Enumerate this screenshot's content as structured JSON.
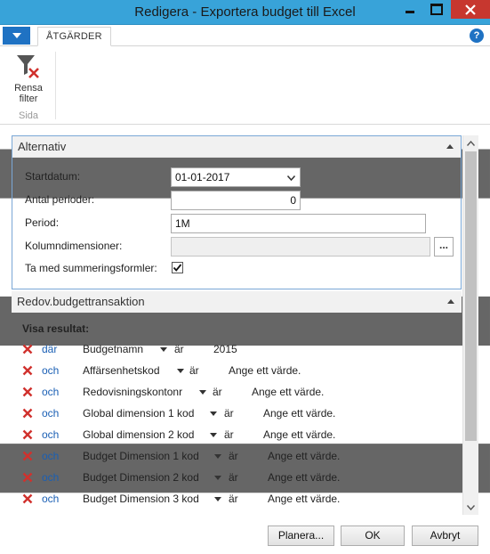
{
  "window": {
    "title": "Redigera - Exportera budget till Excel"
  },
  "ribbon": {
    "tab_label": "ÅTGÄRDER",
    "help_label": "?",
    "clear_filter_line1": "Rensa",
    "clear_filter_line2": "filter",
    "group_label": "Sida"
  },
  "options": {
    "header": "Alternativ",
    "start_date_label": "Startdatum:",
    "start_date_value": "01-01-2017",
    "num_periods_label": "Antal perioder:",
    "num_periods_value": "0",
    "period_label": "Period:",
    "period_value": "1M",
    "column_dims_label": "Kolumndimensioner:",
    "column_dims_value": "",
    "ellipsis_label": "...",
    "include_formulas_label": "Ta med summeringsformler:",
    "include_formulas_checked": true
  },
  "filters": {
    "header": "Redov.budgettransaktion",
    "show_results_label": "Visa resultat:",
    "rows": [
      {
        "conj": "där",
        "field": "Budgetnamn",
        "op": "är",
        "value": "2015"
      },
      {
        "conj": "och",
        "field": "Affärsenhetskod",
        "op": "är",
        "value": "Ange ett värde."
      },
      {
        "conj": "och",
        "field": "Redovisningskontonr",
        "op": "är",
        "value": "Ange ett värde."
      },
      {
        "conj": "och",
        "field": "Global dimension 1 kod",
        "op": "är",
        "value": "Ange ett värde."
      },
      {
        "conj": "och",
        "field": "Global dimension 2 kod",
        "op": "är",
        "value": "Ange ett värde."
      },
      {
        "conj": "och",
        "field": "Budget Dimension 1 kod",
        "op": "är",
        "value": "Ange ett värde."
      },
      {
        "conj": "och",
        "field": "Budget Dimension 2 kod",
        "op": "är",
        "value": "Ange ett värde."
      },
      {
        "conj": "och",
        "field": "Budget Dimension 3 kod",
        "op": "är",
        "value": "Ange ett värde."
      }
    ]
  },
  "footer": {
    "schedule_label": "Planera...",
    "ok_label": "OK",
    "cancel_label": "Avbryt"
  },
  "colors": {
    "titlebar": "#38a3d9",
    "accent": "#1f72c3",
    "close": "#c7372f",
    "link": "#1a5fb4",
    "remove": "#d0312d"
  }
}
